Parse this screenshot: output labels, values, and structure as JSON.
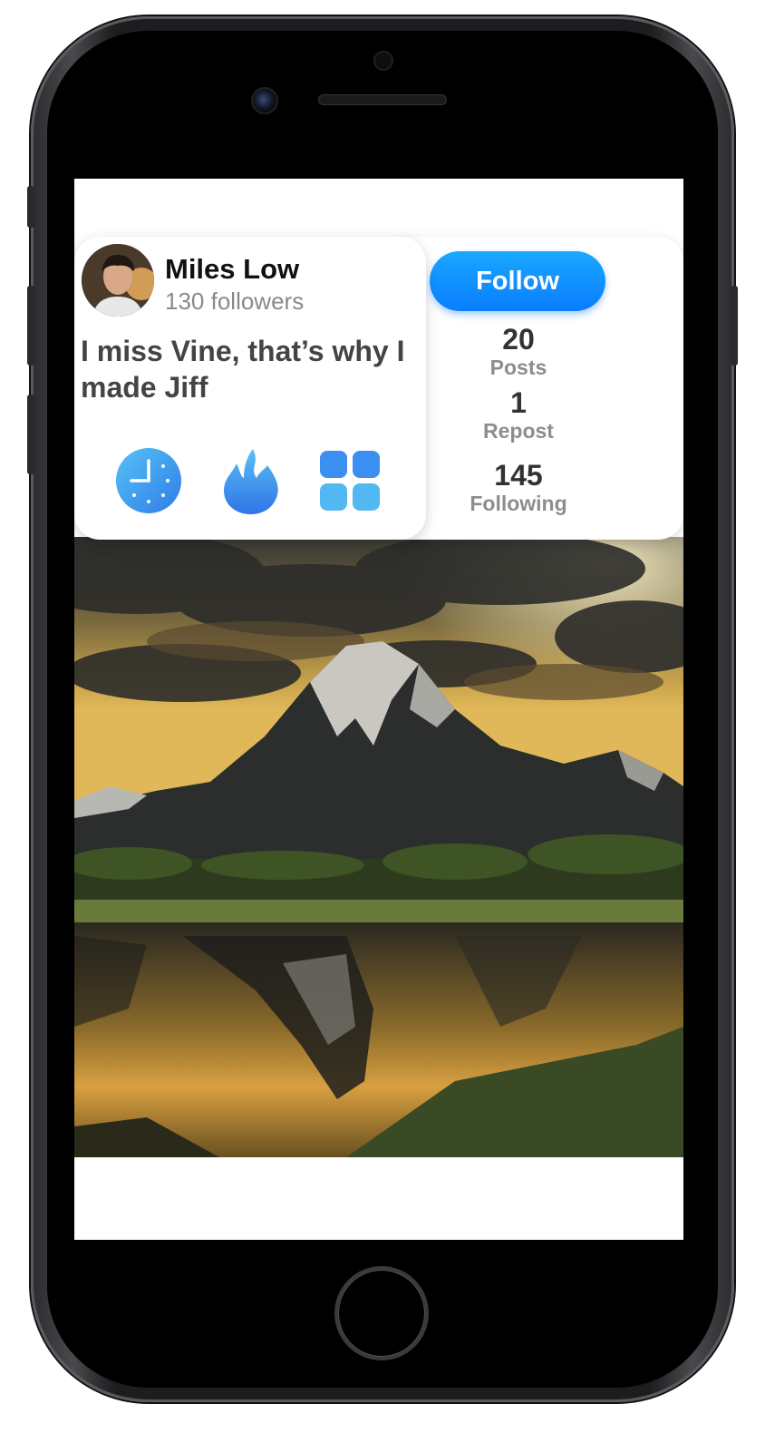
{
  "profile": {
    "name": "Miles Low",
    "followers": "130 followers",
    "bio": "I miss Vine, that’s why I made Jiff",
    "follow_label": "Follow"
  },
  "stats": [
    {
      "value": "20",
      "label": "Posts"
    },
    {
      "value": "1",
      "label": "Repost"
    },
    {
      "value": "145",
      "label": "Following"
    }
  ],
  "actions": [
    {
      "icon": "clock-icon"
    },
    {
      "icon": "flame-icon"
    },
    {
      "icon": "grid-icon"
    }
  ],
  "colors": {
    "accent": "#0a8fff",
    "text_primary": "#111111",
    "text_secondary": "#8a8a8a"
  }
}
